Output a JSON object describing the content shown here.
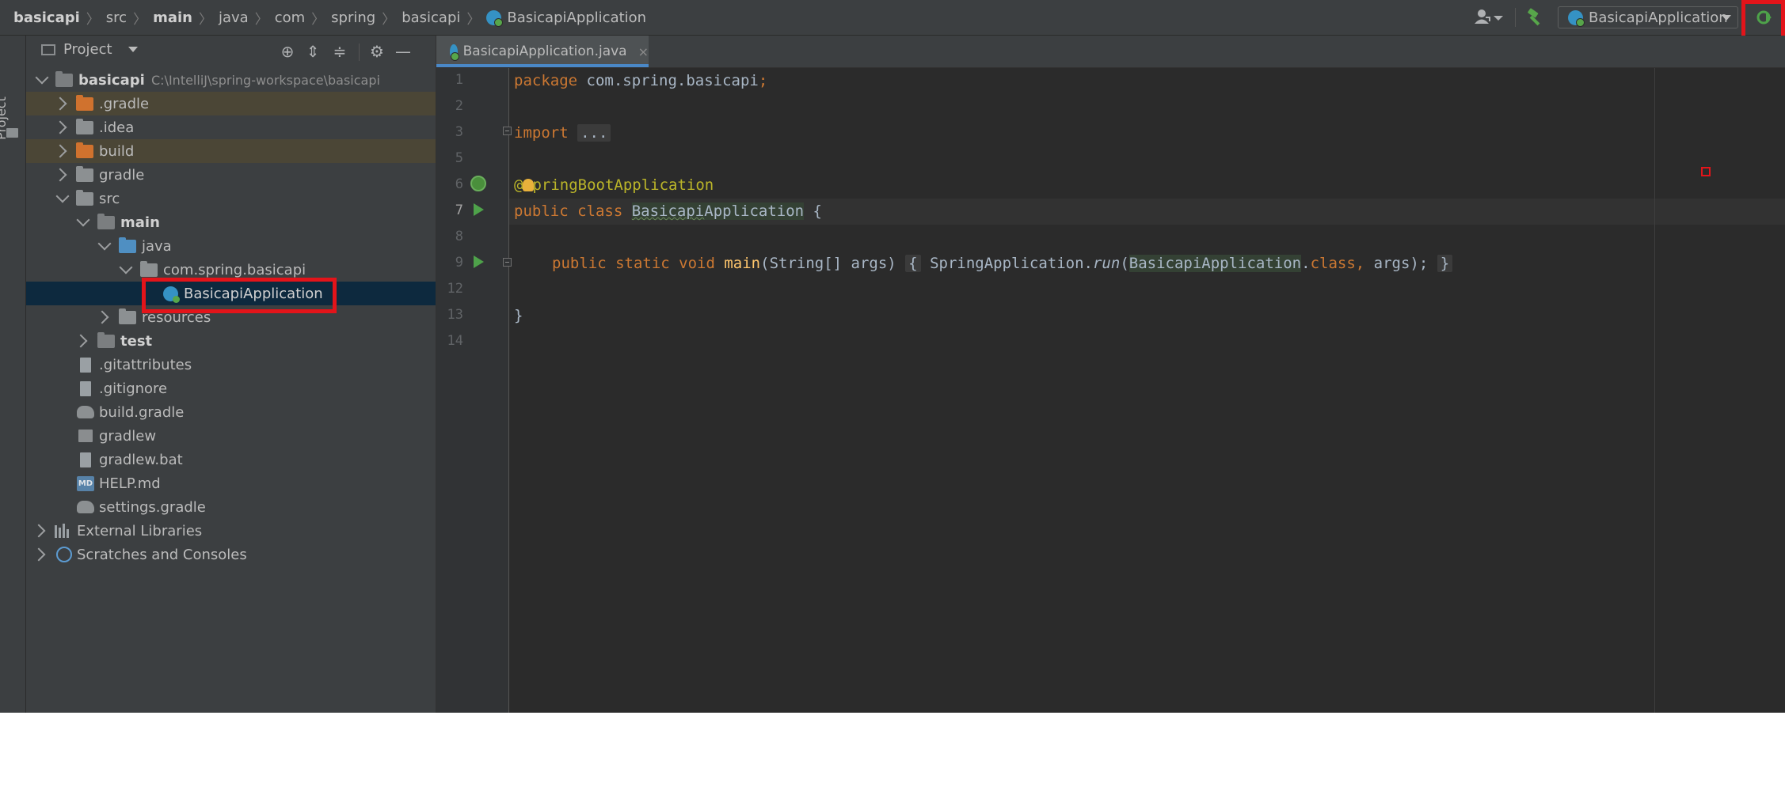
{
  "breadcrumb": {
    "items": [
      "basicapi",
      "src",
      "main",
      "java",
      "com",
      "spring",
      "basicapi"
    ],
    "current": "BasicapiApplication"
  },
  "toolbar": {
    "run_config": "BasicapiApplication"
  },
  "tool_stripe": {
    "label": "Project"
  },
  "project_panel": {
    "title": "Project",
    "root": {
      "name": "basicapi",
      "path": "C:\\IntelliJ\\spring-workspace\\basicapi"
    },
    "items": {
      "gradle_dot": ".gradle",
      "idea": ".idea",
      "build": "build",
      "gradle": "gradle",
      "src": "src",
      "main": "main",
      "java": "java",
      "package": "com.spring.basicapi",
      "app_class": "BasicapiApplication",
      "resources": "resources",
      "test": "test",
      "gitattributes": ".gitattributes",
      "gitignore": ".gitignore",
      "build_gradle": "build.gradle",
      "gradlew": "gradlew",
      "gradlew_bat": "gradlew.bat",
      "help_md": "HELP.md",
      "settings_gradle": "settings.gradle",
      "external_libraries": "External Libraries",
      "scratches": "Scratches and Consoles"
    },
    "md_badge": "MD"
  },
  "editor": {
    "tab": {
      "label": "BasicapiApplication.java",
      "close": "×"
    },
    "line_numbers": [
      "1",
      "2",
      "3",
      "5",
      "6",
      "7",
      "8",
      "9",
      "12",
      "13",
      "14"
    ],
    "code": {
      "l1_kw": "package",
      "l1_pkg": " com.spring.basicapi",
      "l1_semi": ";",
      "l3_kw": "import",
      "l3_fold": "...",
      "l6_ann_at": "@",
      "l6_ann_rest": "pringBootApplication",
      "l7_kw": "public class",
      "l7_cls_a": "Basicapi",
      "l7_cls_b": "Application",
      "l7_brace": " {",
      "l9_kw": "public static void",
      "l9_fn": "main",
      "l9_params": "(String[] args)",
      "l9_open": "{",
      "l9_call": "SpringApplication.",
      "l9_run": "run",
      "l9_paren": "(",
      "l9_arg_cls": "BasicapiApplication",
      "l9_dot": ".",
      "l9_class_kw": "class",
      "l9_comma": ",",
      "l9_args": " args);",
      "l9_close": "}",
      "l13_brace": "}"
    }
  },
  "colors": {
    "keyword": "#cc7832",
    "annotation": "#bbb529",
    "function": "#ffc66d",
    "highlight_red": "#e3141a",
    "selection": "#0d293e"
  }
}
